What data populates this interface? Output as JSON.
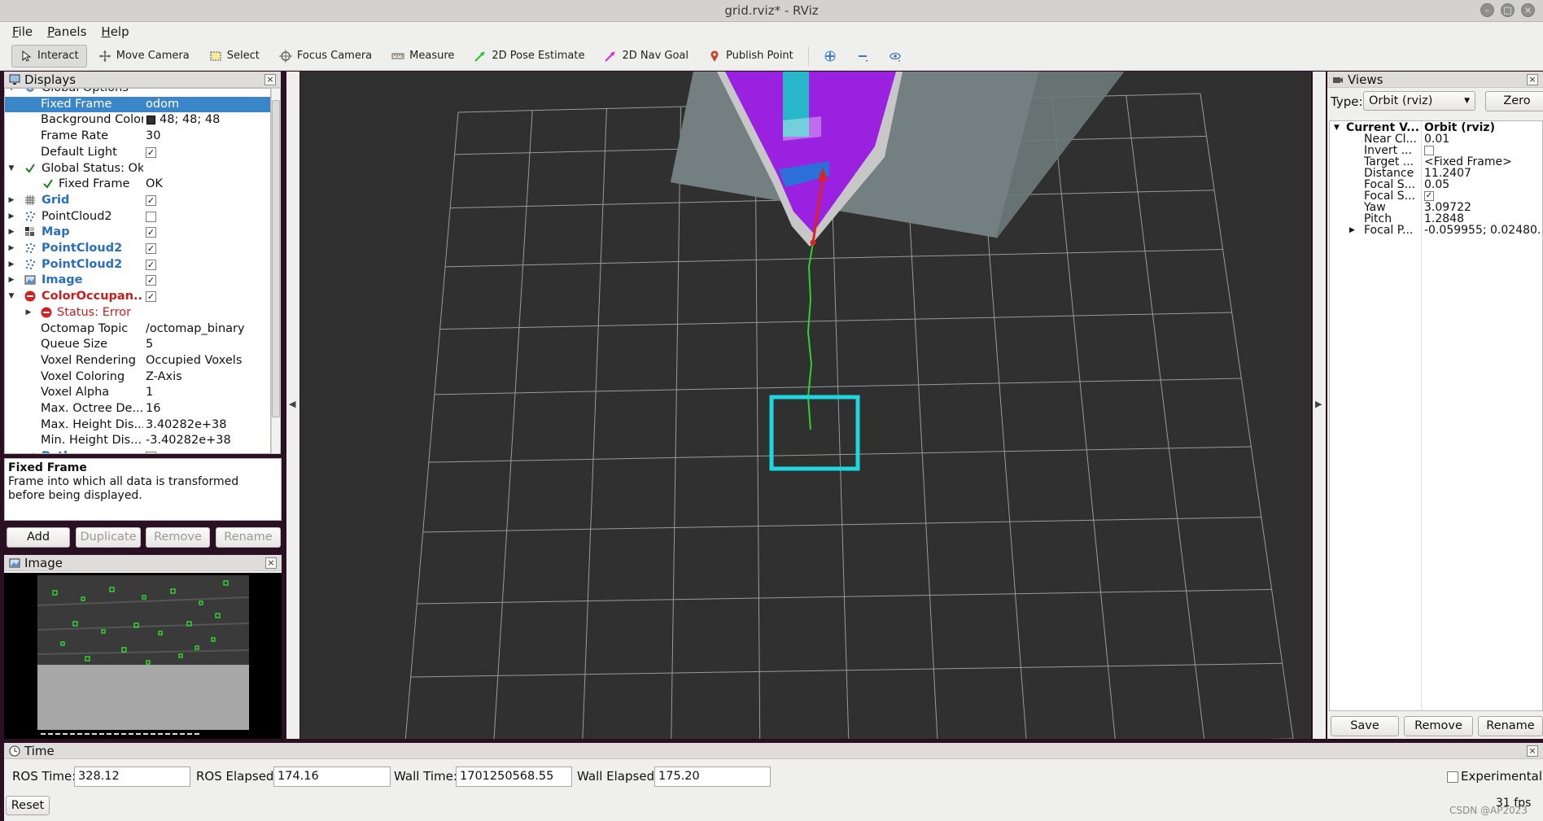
{
  "window": {
    "title": "grid.rviz* - RViz"
  },
  "menu": [
    {
      "first": "F",
      "rest": "ile"
    },
    {
      "first": "P",
      "rest": "anels"
    },
    {
      "first": "H",
      "rest": "elp"
    }
  ],
  "toolbar": {
    "interact": "Interact",
    "move_camera": "Move Camera",
    "select": "Select",
    "focus_camera": "Focus Camera",
    "measure": "Measure",
    "pose_estimate": "2D Pose Estimate",
    "nav_goal": "2D Nav Goal",
    "publish_point": "Publish Point"
  },
  "displays": {
    "title": "Displays",
    "rows": [
      {
        "name": "Global Options",
        "value": ""
      },
      {
        "name": "Fixed Frame",
        "value": "odom"
      },
      {
        "name": "Background Color",
        "value": "48; 48; 48"
      },
      {
        "name": "Frame Rate",
        "value": "30"
      },
      {
        "name": "Default Light",
        "value": ""
      },
      {
        "name": "Global Status: Ok",
        "value": ""
      },
      {
        "name": "Fixed Frame",
        "value": "OK"
      },
      {
        "name": "Grid",
        "value": ""
      },
      {
        "name": "PointCloud2",
        "value": ""
      },
      {
        "name": "Map",
        "value": ""
      },
      {
        "name": "PointCloud2",
        "value": ""
      },
      {
        "name": "PointCloud2",
        "value": ""
      },
      {
        "name": "Image",
        "value": ""
      },
      {
        "name": "ColorOccupan...",
        "value": ""
      },
      {
        "name": "Status: Error",
        "value": ""
      },
      {
        "name": "Octomap Topic",
        "value": "/octomap_binary"
      },
      {
        "name": "Queue Size",
        "value": "5"
      },
      {
        "name": "Voxel Rendering",
        "value": "Occupied Voxels"
      },
      {
        "name": "Voxel Coloring",
        "value": "Z-Axis"
      },
      {
        "name": "Voxel Alpha",
        "value": "1"
      },
      {
        "name": "Max. Octree De...",
        "value": "16"
      },
      {
        "name": "Max. Height Dis...",
        "value": "3.40282e+38"
      },
      {
        "name": "Min. Height Dis...",
        "value": "-3.40282e+38"
      },
      {
        "name": "Path",
        "value": ""
      }
    ],
    "description_title": "Fixed Frame",
    "description_text": "Frame into which all data is transformed before being displayed.",
    "buttons": {
      "add": "Add",
      "duplicate": "Duplicate",
      "remove": "Remove",
      "rename": "Rename"
    }
  },
  "image_panel": {
    "title": "Image"
  },
  "views": {
    "title": "Views",
    "type_label": "Type:",
    "type_value": "Orbit (rviz)",
    "zero": "Zero",
    "rows": [
      {
        "name": "Current V...",
        "value": "Orbit (rviz)"
      },
      {
        "name": "Near Cl...",
        "value": "0.01"
      },
      {
        "name": "Invert ...",
        "value": ""
      },
      {
        "name": "Target ...",
        "value": "<Fixed Frame>"
      },
      {
        "name": "Distance",
        "value": "11.2407"
      },
      {
        "name": "Focal S...",
        "value": "0.05"
      },
      {
        "name": "Focal S...",
        "value": ""
      },
      {
        "name": "Yaw",
        "value": "3.09722"
      },
      {
        "name": "Pitch",
        "value": "1.2848"
      },
      {
        "name": "Focal P...",
        "value": "-0.059955; 0.02480..."
      }
    ],
    "buttons": {
      "save": "Save",
      "remove": "Remove",
      "rename": "Rename"
    }
  },
  "time": {
    "title": "Time",
    "ros_time_label": "ROS Time:",
    "ros_time": "328.12",
    "ros_elapsed_label": "ROS Elapsed:",
    "ros_elapsed": "174.16",
    "wall_time_label": "Wall Time:",
    "wall_time": "1701250568.55",
    "wall_elapsed_label": "Wall Elapsed:",
    "wall_elapsed": "175.20",
    "experimental": "Experimental",
    "reset": "Reset",
    "fps": "31 fps"
  },
  "watermark": "CSDN @AP2023"
}
